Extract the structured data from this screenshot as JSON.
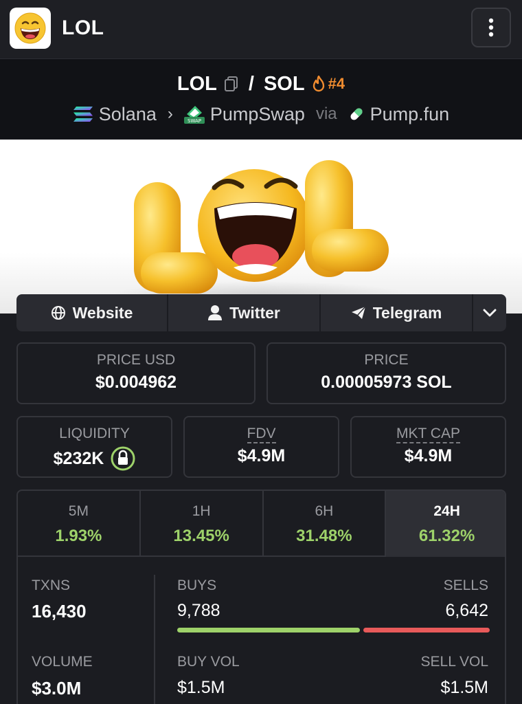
{
  "header": {
    "title": "LOL"
  },
  "pair": {
    "base": "LOL",
    "slash": "/",
    "quote": "SOL",
    "rank": "#4",
    "chain": "Solana",
    "dex": "PumpSwap",
    "via": "via",
    "launchpad": "Pump.fun",
    "swap_badge": "SWAP"
  },
  "links": {
    "website": "Website",
    "twitter": "Twitter",
    "telegram": "Telegram"
  },
  "stats": {
    "price_usd_label": "PRICE USD",
    "price_usd": "$0.004962",
    "price_label": "PRICE",
    "price": "0.00005973 SOL",
    "liquidity_label": "LIQUIDITY",
    "liquidity": "$232K",
    "fdv_label": "FDV",
    "fdv": "$4.9M",
    "mktcap_label": "MKT CAP",
    "mktcap": "$4.9M"
  },
  "timeframes": [
    {
      "label": "5M",
      "change": "1.93%"
    },
    {
      "label": "1H",
      "change": "13.45%"
    },
    {
      "label": "6H",
      "change": "31.48%"
    },
    {
      "label": "24H",
      "change": "61.32%"
    }
  ],
  "activity": {
    "txns_label": "TXNS",
    "txns": "16,430",
    "buys_label": "BUYS",
    "buys": "9,788",
    "sells_label": "SELLS",
    "sells": "6,642",
    "volume_label": "VOLUME",
    "volume": "$3.0M",
    "buy_vol_label": "BUY VOL",
    "buy_vol": "$1.5M",
    "sell_vol_label": "SELL VOL",
    "sell_vol": "$1.5M",
    "buy_share": 0.596
  },
  "colors": {
    "positive": "#9ed26a",
    "negative": "#e85a5a",
    "rank": "#f08c30",
    "background": "#1b1c21"
  },
  "banner": {
    "letters": [
      "L",
      "L"
    ]
  }
}
